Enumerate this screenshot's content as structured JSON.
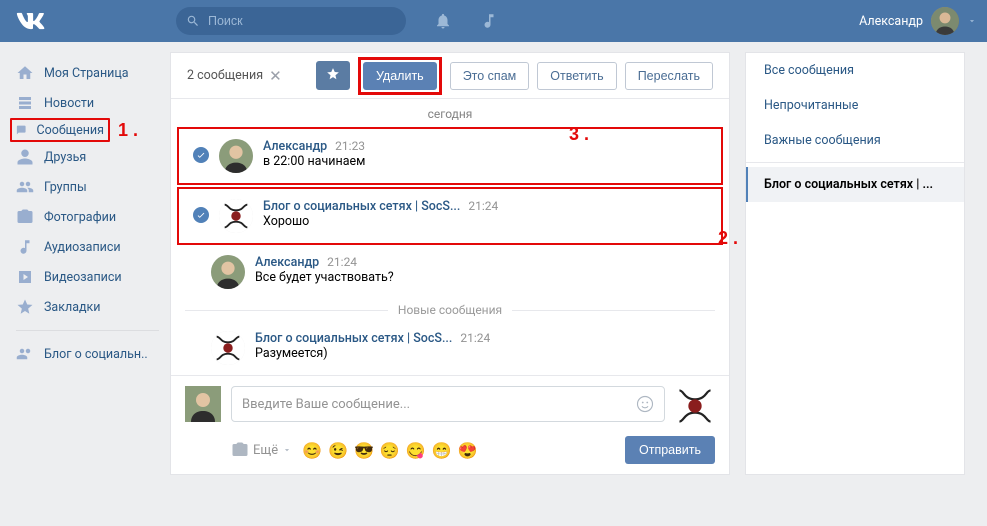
{
  "header": {
    "search_placeholder": "Поиск",
    "user_name": "Александр"
  },
  "sidebar": {
    "items": [
      {
        "label": "Моя Страница",
        "icon": "home"
      },
      {
        "label": "Новости",
        "icon": "news"
      },
      {
        "label": "Сообщения",
        "icon": "messages",
        "highlighted": true
      },
      {
        "label": "Друзья",
        "icon": "friends"
      },
      {
        "label": "Группы",
        "icon": "groups"
      },
      {
        "label": "Фотографии",
        "icon": "photos"
      },
      {
        "label": "Аудиозаписи",
        "icon": "audio"
      },
      {
        "label": "Видеозаписи",
        "icon": "video"
      },
      {
        "label": "Закладки",
        "icon": "bookmarks"
      }
    ],
    "extra": {
      "label": "Блог о социальн.."
    }
  },
  "chat": {
    "selection_count": "2 сообщения",
    "actions": {
      "delete": "Удалить",
      "spam": "Это спам",
      "reply": "Ответить",
      "forward": "Переслать"
    },
    "date_label": "сегодня",
    "new_label": "Новые сообщения",
    "messages": [
      {
        "author": "Александр",
        "time": "21:23",
        "text": "в 22:00 начинаем",
        "selected": true,
        "avatar": "user"
      },
      {
        "author": "Блог о социальных сетях | SocS...",
        "time": "21:24",
        "text": "Хорошо",
        "selected": true,
        "avatar": "group"
      },
      {
        "author": "Александр",
        "time": "21:24",
        "text": "Все будет участвовать?",
        "selected": false,
        "avatar": "user"
      },
      {
        "author": "Блог о социальных сетях | SocS...",
        "time": "21:24",
        "text": "Разумеется)",
        "selected": false,
        "avatar": "group",
        "after_new": true
      }
    ],
    "compose": {
      "placeholder": "Введите Ваше сообщение...",
      "attach": "Ещё",
      "send": "Отправить"
    }
  },
  "right": {
    "filters": [
      "Все сообщения",
      "Непрочитанные",
      "Важные сообщения"
    ],
    "active": "Блог о социальных сетях | ..."
  },
  "annotations": {
    "a1": "1 .",
    "a2": "2 .",
    "a3": "3 ."
  }
}
